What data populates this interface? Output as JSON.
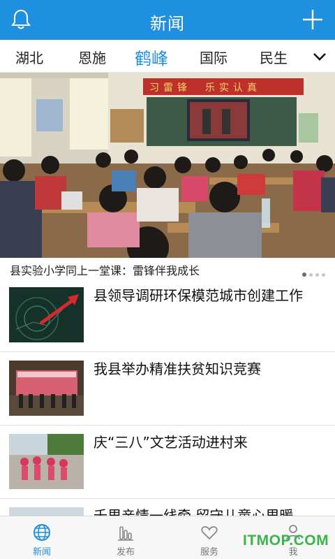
{
  "header": {
    "title": "新闻",
    "left_icon": "bell-icon",
    "right_icon": "plus-icon"
  },
  "tabs": [
    {
      "label": "湖北",
      "active": false
    },
    {
      "label": "恩施",
      "active": false
    },
    {
      "label": "鹤峰",
      "active": true
    },
    {
      "label": "国际",
      "active": false
    },
    {
      "label": "民生",
      "active": false
    }
  ],
  "tabs_more_icon": "chevron-down-icon",
  "banner": {
    "caption": "县实验小学同上一堂课：雷锋伴我成长",
    "classroom_sign": "习雷锋　乐实认真",
    "dots_total": 4,
    "dots_active": 1
  },
  "news": [
    {
      "headline": "县领导调研环保模范城市创建工作",
      "thumb": "red-arrow-chart-photo"
    },
    {
      "headline": "我县举办精准扶贫知识竞赛",
      "thumb": "stage-event-photo"
    },
    {
      "headline": "庆“三八”文艺活动进村来",
      "thumb": "dancers-photo"
    },
    {
      "headline": "千里亲情一线牵 留守儿童心里暖",
      "thumb": "partial-photo"
    }
  ],
  "bottom_nav": [
    {
      "label": "新闻",
      "icon": "globe-icon",
      "active": true
    },
    {
      "label": "发布",
      "icon": "bars-icon",
      "active": false
    },
    {
      "label": "服务",
      "icon": "heart-icon",
      "active": false
    },
    {
      "label": "我",
      "icon": "user-icon",
      "active": false
    }
  ],
  "watermark": "ITMOP.COM",
  "colors": {
    "brand_blue": "#1f8fdf",
    "watermark_green": "#39b54a"
  }
}
